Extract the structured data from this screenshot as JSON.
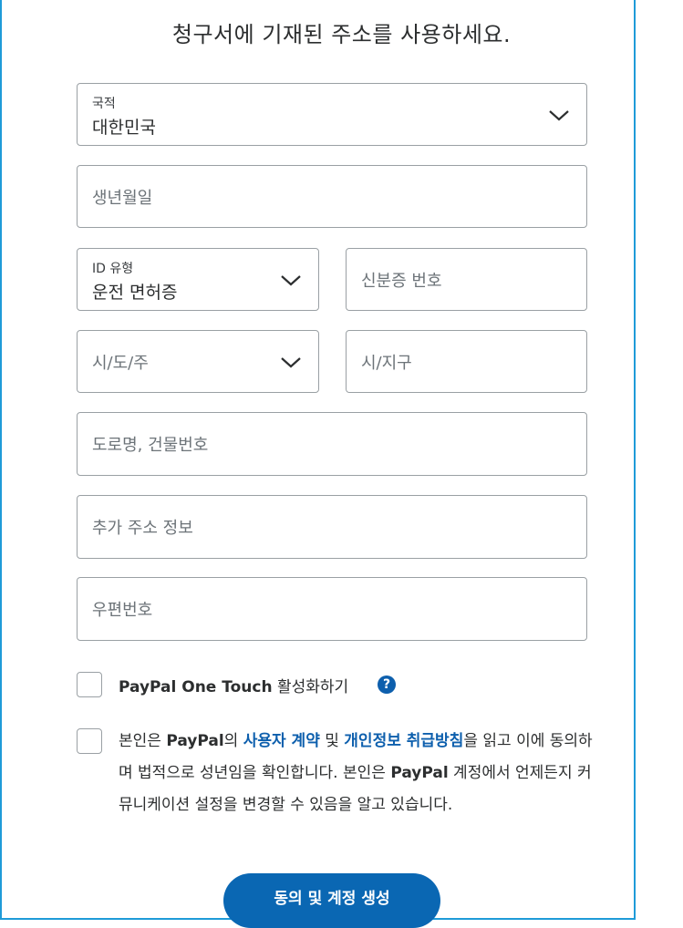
{
  "heading": "청구서에 기재된 주소를 사용하세요.",
  "country": {
    "label": "국적",
    "value": "대한민국"
  },
  "birthdate": {
    "placeholder": "생년월일"
  },
  "id_type": {
    "label": "ID 유형",
    "value": "운전 면허증"
  },
  "id_number": {
    "placeholder": "신분증 번호"
  },
  "state": {
    "placeholder": "시/도/주"
  },
  "city": {
    "placeholder": "시/지구"
  },
  "address1": {
    "placeholder": "도로명, 건물번호"
  },
  "address2": {
    "placeholder": "추가 주소 정보"
  },
  "postal": {
    "placeholder": "우편번호"
  },
  "one_touch": {
    "brand": "PayPal One Touch",
    "suffix": " 활성화하기",
    "help": "?"
  },
  "consent": {
    "p1": "본인은 ",
    "brand1": "PayPal",
    "p2": "의 ",
    "link1": "사용자 계약",
    "p3": " 및 ",
    "link2": "개인정보 취급방침",
    "p4": "을 읽고 이에 동의하며 법적으로 성년임을 확인합니다. 본인은 ",
    "brand2": "PayPal",
    "p5": " 계정에서 언제든지 커뮤니케이션 설정을 변경할 수 있음을 알고 있습니다."
  },
  "submit_label": "동의 및 계정 생성",
  "colors": {
    "link": "#0d5fad",
    "button": "#0a67b3",
    "frame": "#1f9bd8"
  }
}
